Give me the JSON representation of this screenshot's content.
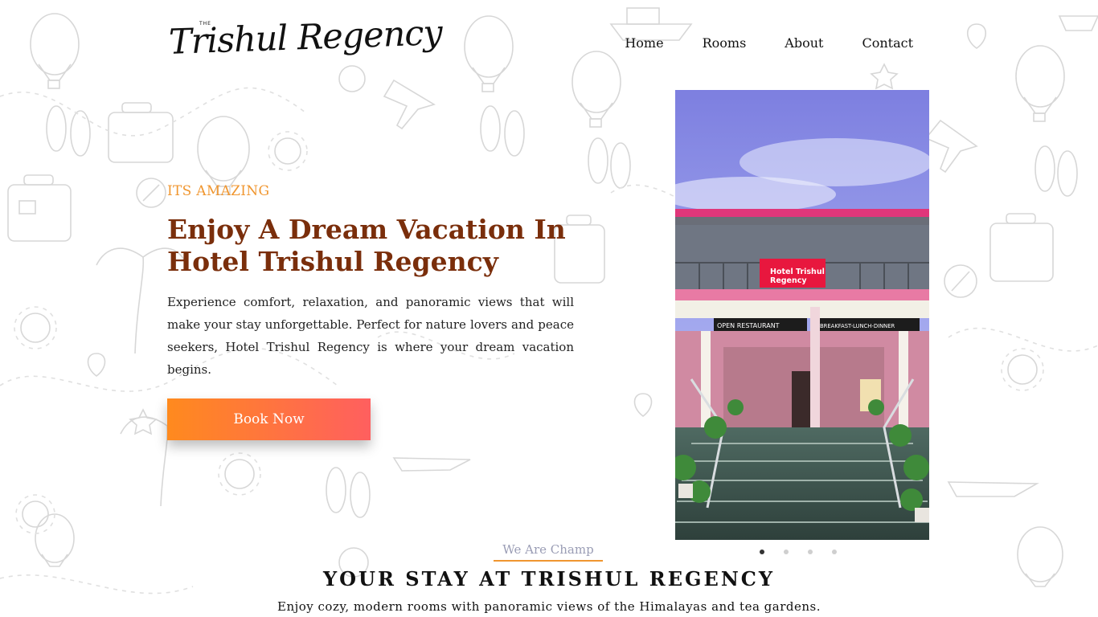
{
  "brand": {
    "logo_small": "THE",
    "logo_text": "Trishul Regency"
  },
  "nav": {
    "items": [
      "Home",
      "Rooms",
      "About",
      "Contact"
    ]
  },
  "hero": {
    "eyebrow": "ITS AMAZING",
    "headline_line1": "Enjoy A Dream Vacation In",
    "headline_line2": "Hotel Trishul Regency",
    "description": "Experience comfort, relaxation, and panoramic views that will make your stay unforgettable. Perfect for nature lovers and peace seekers, Hotel Trishul Regency is where your dream vacation begins.",
    "cta_label": "Book Now"
  },
  "photo": {
    "sign_line1": "Hotel Trishul",
    "sign_line2": "Regency",
    "banner_left": "OPEN RESTAURANT",
    "banner_right": "BREAKFAST-LUNCH-DINNER"
  },
  "carousel": {
    "slide_count": 4,
    "active_index": 0
  },
  "section": {
    "kicker": "We Are Champ",
    "title": "YOUR STAY AT TRISHUL REGENCY",
    "subtitle": "Enjoy cozy, modern rooms with panoramic views of the Himalayas and tea gardens."
  },
  "colors": {
    "accent_orange": "#f0962f",
    "headline_brown": "#7a2e0b",
    "cta_gradient_start": "#ff8a1e",
    "cta_gradient_end": "#ff5f5f"
  }
}
